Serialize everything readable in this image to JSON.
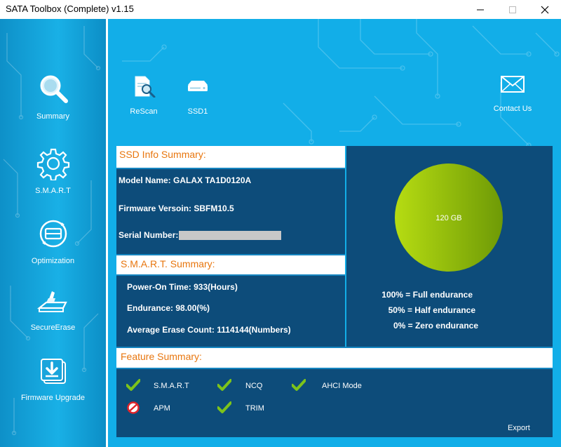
{
  "window": {
    "title": "SATA Toolbox (Complete) v1.15"
  },
  "sidebar": {
    "items": [
      {
        "label": "Summary",
        "icon": "magnifier-icon"
      },
      {
        "label": "S.M.A.R.T",
        "icon": "gear-icon"
      },
      {
        "label": "Optimization",
        "icon": "optimization-icon"
      },
      {
        "label": "SecureErase",
        "icon": "erase-icon"
      },
      {
        "label": "Firmware Upgrade",
        "icon": "firmware-download-icon"
      }
    ]
  },
  "toolbar": {
    "rescan_label": "ReScan",
    "ssd_label": "SSD1",
    "contact_label": "Contact Us"
  },
  "ssd_info": {
    "heading": "SSD Info Summary:",
    "model_name": "Model Name: GALAX TA1D0120A",
    "firmware": "Firmware Versoin: SBFM10.5",
    "serial_label": "Serial Number:"
  },
  "smart": {
    "heading": "S.M.A.R.T. Summary:",
    "power_on": "Power-On Time: 933(Hours)",
    "endurance": "Endurance: 98.00(%)",
    "erase_count": "Average Erase Count: 1114144(Numbers)"
  },
  "disk": {
    "capacity": "120 GB",
    "legend": [
      "100% = Full endurance",
      "50% = Half endurance",
      "0% = Zero endurance"
    ],
    "colors": {
      "fill_light": "#b6dc12",
      "fill_dark": "#6e9a06"
    }
  },
  "features": {
    "heading": "Feature Summary:",
    "items": [
      {
        "label": "S.M.A.R.T",
        "supported": true
      },
      {
        "label": "NCQ",
        "supported": true
      },
      {
        "label": "AHCI Mode",
        "supported": true
      },
      {
        "label": "APM",
        "supported": false
      },
      {
        "label": "TRIM",
        "supported": true
      }
    ],
    "export_label": "Export"
  },
  "colors": {
    "accent_orange": "#e8760e",
    "panel_navy": "#0d4c7a",
    "background_cyan": "#12aee8",
    "check_green": "#7dc31a",
    "no_red": "#e0242a"
  }
}
